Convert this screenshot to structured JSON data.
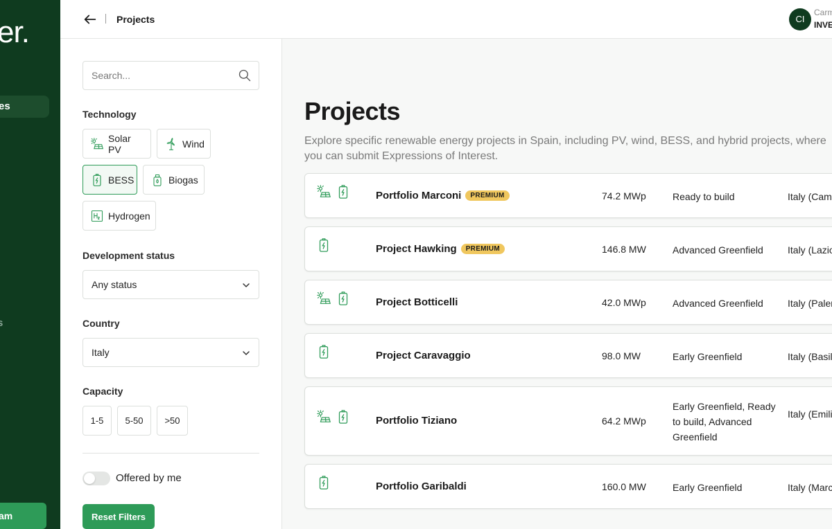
{
  "sidebar": {
    "logo": "er.",
    "active_item": "es",
    "item": "s",
    "cta": "am"
  },
  "header": {
    "breadcrumb": "Projects",
    "avatar_initials": "CI",
    "user_name": "Carm",
    "user_role": "INVE"
  },
  "filters": {
    "search_placeholder": "Search...",
    "technology_label": "Technology",
    "technologies": [
      {
        "label": "Solar PV",
        "icon": "solar-icon"
      },
      {
        "label": "Wind",
        "icon": "wind-icon"
      },
      {
        "label": "BESS",
        "icon": "battery-icon",
        "active": true
      },
      {
        "label": "Biogas",
        "icon": "biogas-icon"
      },
      {
        "label": "Hydrogen",
        "icon": "hydrogen-icon"
      }
    ],
    "status_label": "Development status",
    "status_value": "Any status",
    "country_label": "Country",
    "country_value": "Italy",
    "capacity_label": "Capacity",
    "capacities": [
      "1-5",
      "5-50",
      ">50"
    ],
    "offered_label": "Offered by me",
    "offered_on": false,
    "reset_label": "Reset Filters"
  },
  "main": {
    "title": "Projects",
    "description": "Explore specific renewable energy projects in Spain, including PV, wind, BESS, and hybrid projects, where you can submit Expressions of Interest.",
    "projects": [
      {
        "name": "Portfolio Marconi",
        "premium": "PREMIUM",
        "capacity": "74.2 MWp",
        "status": "Ready to build",
        "country": "Italy (Campania)",
        "icons": [
          "solar-icon",
          "battery-icon"
        ]
      },
      {
        "name": "Project Hawking",
        "premium": "PREMIUM",
        "capacity": "146.8 MW",
        "status": "Advanced Greenfield",
        "country": "Italy (Lazio)",
        "icons": [
          "battery-icon"
        ]
      },
      {
        "name": "Project Botticelli",
        "premium": "",
        "capacity": "42.0 MWp",
        "status": "Advanced Greenfield",
        "country": "Italy (Palermo)",
        "icons": [
          "solar-icon",
          "battery-icon"
        ]
      },
      {
        "name": "Project Caravaggio",
        "premium": "",
        "capacity": "98.0 MW",
        "status": "Early Greenfield",
        "country": "Italy (Basilicata)",
        "icons": [
          "battery-icon"
        ]
      },
      {
        "name": "Portfolio Tiziano",
        "premium": "",
        "capacity": "64.2 MWp",
        "status": "Early Greenfield, Ready to build, Advanced Greenfield",
        "country": "Italy (Emilia, Sicily)",
        "icons": [
          "solar-icon",
          "battery-icon"
        ]
      },
      {
        "name": "Portfolio Garibaldi",
        "premium": "",
        "capacity": "160.0 MW",
        "status": "Early Greenfield",
        "country": "Italy (Marche)",
        "icons": [
          "battery-icon"
        ]
      }
    ]
  },
  "colors": {
    "sidebar_bg": "#0f3b1f",
    "accent_green": "#2e9b58",
    "premium_badge": "#f0c75e"
  }
}
